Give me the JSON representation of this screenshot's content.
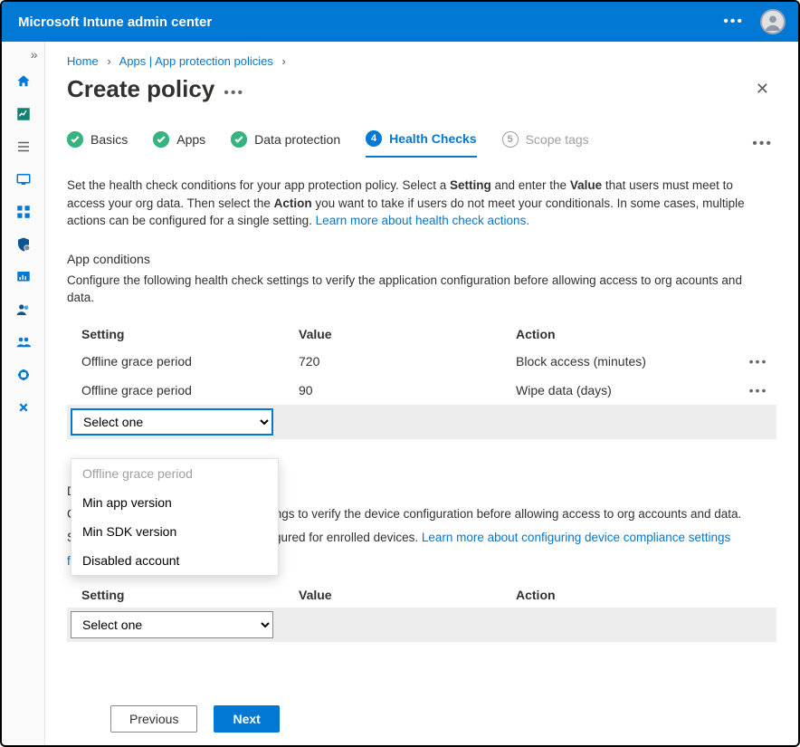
{
  "banner": {
    "title": "Microsoft Intune admin center"
  },
  "breadcrumb": {
    "home": "Home",
    "apps": "Apps | App protection policies"
  },
  "page": {
    "title": "Create policy"
  },
  "steps": [
    {
      "num": "✓",
      "label": "Basics",
      "state": "done"
    },
    {
      "num": "✓",
      "label": "Apps",
      "state": "done"
    },
    {
      "num": "✓",
      "label": "Data protection",
      "state": "done"
    },
    {
      "num": "4",
      "label": "Health Checks",
      "state": "active"
    },
    {
      "num": "5",
      "label": "Scope tags",
      "state": "future"
    }
  ],
  "intro": {
    "t1": "Set the health check conditions for your app protection policy. Select a ",
    "b1": "Setting",
    "t2": " and enter the ",
    "b2": "Value",
    "t3": " that users must meet to access your org data. Then select the ",
    "b3": "Action",
    "t4": " you want to take if users do not meet your conditionals. In some cases, multiple actions can be configured for a single setting. ",
    "link": "Learn more about health check actions."
  },
  "app_conditions": {
    "heading": "App conditions",
    "desc": "Configure the following health check settings to verify the application configuration before allowing access to org acounts and data.",
    "columns": {
      "setting": "Setting",
      "value": "Value",
      "action": "Action"
    },
    "rows": [
      {
        "setting": "Offline grace period",
        "value": "720",
        "action": "Block access (minutes)"
      },
      {
        "setting": "Offline grace period",
        "value": "90",
        "action": "Wipe data (days)"
      }
    ],
    "select_placeholder": "Select one",
    "dropdown": [
      {
        "label": "Offline grace period",
        "disabled": true
      },
      {
        "label": "Min app version",
        "disabled": false
      },
      {
        "label": "Min SDK version",
        "disabled": false
      },
      {
        "label": "Disabled account",
        "disabled": false
      }
    ]
  },
  "device_conditions": {
    "heading_initial": "D",
    "line1_prefix": "C",
    "line1_rest": "ngs to verify the device configuration before allowing access to org accounts and data.",
    "line2_prefix": "S",
    "line2_rest": "gured for enrolled devices. ",
    "line2_link": "Learn more about configuring device compliance settings",
    "line3_prefix": "f",
    "columns": {
      "setting": "Setting",
      "value": "Value",
      "action": "Action"
    },
    "select_placeholder": "Select one"
  },
  "footer": {
    "previous": "Previous",
    "next": "Next"
  }
}
